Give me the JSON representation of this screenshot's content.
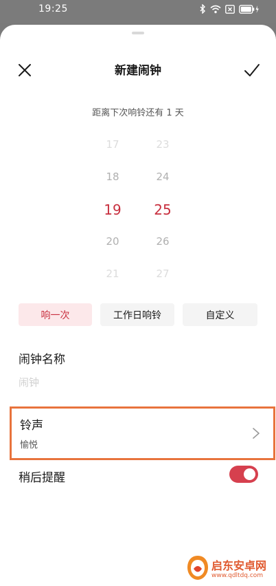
{
  "status_bar": {
    "time": "19:25",
    "icons": [
      "bluetooth-icon",
      "wifi-icon",
      "sim-x-icon",
      "battery-charging-icon"
    ]
  },
  "header": {
    "title": "新建闹钟",
    "close_icon": "close-icon",
    "confirm_icon": "check-icon"
  },
  "countdown": "距离下次响铃还有 1 天",
  "time_picker": {
    "hours": [
      "17",
      "18",
      "19",
      "20",
      "21"
    ],
    "minutes": [
      "23",
      "24",
      "25",
      "26",
      "27"
    ],
    "selected_hour": "19",
    "selected_minute": "25",
    "accent_color": "#c8303f"
  },
  "repeat_options": [
    {
      "label": "响一次",
      "active": true
    },
    {
      "label": "工作日响铃",
      "active": false
    },
    {
      "label": "自定义",
      "active": false
    }
  ],
  "alarm_name": {
    "label": "闹钟名称",
    "value": "",
    "placeholder": "闹钟"
  },
  "ringtone": {
    "label": "铃声",
    "value": "愉悦",
    "highlight_color": "#e8733c"
  },
  "snooze": {
    "label": "稍后提醒",
    "enabled": true,
    "toggle_color": "#d6404e"
  },
  "watermark": {
    "text": "启东安卓网",
    "url": "www.qdltdq.com"
  }
}
